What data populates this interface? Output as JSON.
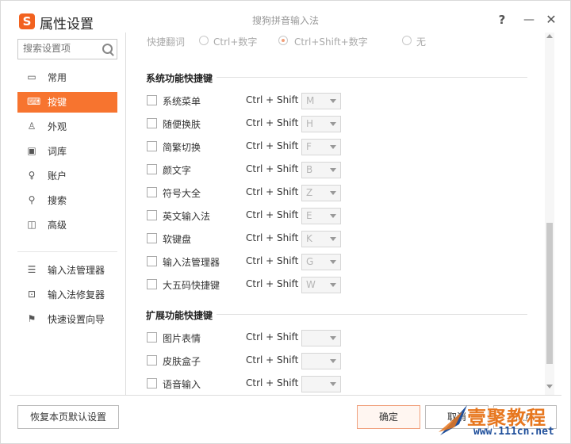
{
  "window": {
    "app_title": "属性设置",
    "center_title": "搜狗拼音输入法",
    "logo_letter": "S",
    "help_label": "?",
    "minimize_label": "—",
    "close_label": "✕"
  },
  "sidebar": {
    "search_placeholder": "搜索设置项",
    "items": [
      {
        "label": "常用",
        "icon": "monitor-icon"
      },
      {
        "label": "按键",
        "icon": "keyboard-icon",
        "active": true
      },
      {
        "label": "外观",
        "icon": "shirt-icon"
      },
      {
        "label": "词库",
        "icon": "book-icon"
      },
      {
        "label": "账户",
        "icon": "user-icon"
      },
      {
        "label": "搜索",
        "icon": "search-icon"
      },
      {
        "label": "高级",
        "icon": "square-icon"
      }
    ],
    "tools": [
      {
        "label": "输入法管理器",
        "icon": "list-icon"
      },
      {
        "label": "输入法修复器",
        "icon": "toolbox-icon"
      },
      {
        "label": "快速设置向导",
        "icon": "flag-icon"
      }
    ]
  },
  "main": {
    "top_row": {
      "label": "快捷翻词",
      "options": [
        "Ctrl+数字",
        "Ctrl+Shift+数字",
        "无"
      ],
      "selected_index": 1
    },
    "system_section": {
      "title": "系统功能快捷键",
      "prefix": "Ctrl + Shift +",
      "rows": [
        {
          "name": "系统菜单",
          "key": "M"
        },
        {
          "name": "随便换肤",
          "key": "H"
        },
        {
          "name": "简繁切换",
          "key": "F"
        },
        {
          "name": "颜文字",
          "key": "B"
        },
        {
          "name": "符号大全",
          "key": "Z"
        },
        {
          "name": "英文输入法",
          "key": "E"
        },
        {
          "name": "软键盘",
          "key": "K"
        },
        {
          "name": "输入法管理器",
          "key": "G"
        },
        {
          "name": "大五码快捷键",
          "key": "W"
        }
      ]
    },
    "extended_section": {
      "title": "扩展功能快捷键",
      "prefix": "Ctrl + Shift +",
      "rows": [
        {
          "name": "图片表情",
          "key": ""
        },
        {
          "name": "皮肤盒子",
          "key": ""
        },
        {
          "name": "语音输入",
          "key": ""
        }
      ]
    }
  },
  "footer": {
    "restore_label": "恢复本页默认设置",
    "ok_label": "确定",
    "cancel_label": "取消",
    "apply_label": "应用"
  },
  "watermark": {
    "text": "壹聚教程",
    "url": "www.111cn.net"
  }
}
